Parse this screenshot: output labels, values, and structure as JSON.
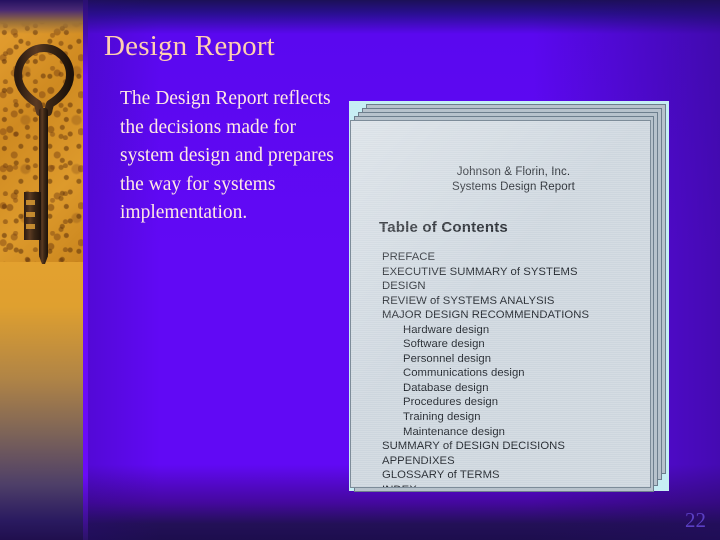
{
  "slide": {
    "title": "Design Report",
    "body": "The Design Report reflects the decisions made for system design and prepares the way for systems implementation.",
    "page_number": "22",
    "colors": {
      "background_top": "#1b1057",
      "background_mid": "#6109f5",
      "background_bottom": "#1d0e4e",
      "title_text": "#ffcfb0",
      "body_text": "#ffe9e4",
      "page_number_text": "#5b3fc4",
      "document_border": "#c6eef4",
      "document_page": "#cdd6de",
      "sheet_edge": "#b7c2cc",
      "strip_photo": "#d9912a"
    }
  },
  "sidebar": {
    "image_alt": "antique skeleton key on orange textured ground"
  },
  "document": {
    "company_line_1": "Johnson & Florin, Inc.",
    "company_line_2": "Systems Design Report",
    "toc_heading": "Table of Contents",
    "toc_entries": [
      {
        "label": "PREFACE",
        "level": 0
      },
      {
        "label": "EXECUTIVE SUMMARY of SYSTEMS",
        "level": 0
      },
      {
        "label": "DESIGN",
        "level": 0
      },
      {
        "label": "REVIEW of SYSTEMS ANALYSIS",
        "level": 0
      },
      {
        "label": "MAJOR DESIGN RECOMMENDATIONS",
        "level": 0
      },
      {
        "label": "Hardware design",
        "level": 1
      },
      {
        "label": "Software design",
        "level": 1
      },
      {
        "label": "Personnel design",
        "level": 1
      },
      {
        "label": "Communications design",
        "level": 1
      },
      {
        "label": "Database design",
        "level": 1
      },
      {
        "label": "Procedures design",
        "level": 1
      },
      {
        "label": "Training design",
        "level": 1
      },
      {
        "label": "Maintenance design",
        "level": 1
      },
      {
        "label": "SUMMARY of DESIGN DECISIONS",
        "level": 0
      },
      {
        "label": "APPENDIXES",
        "level": 0
      },
      {
        "label": "GLOSSARY of TERMS",
        "level": 0
      },
      {
        "label": "INDEX",
        "level": 0
      }
    ],
    "sheet_count": 4
  }
}
